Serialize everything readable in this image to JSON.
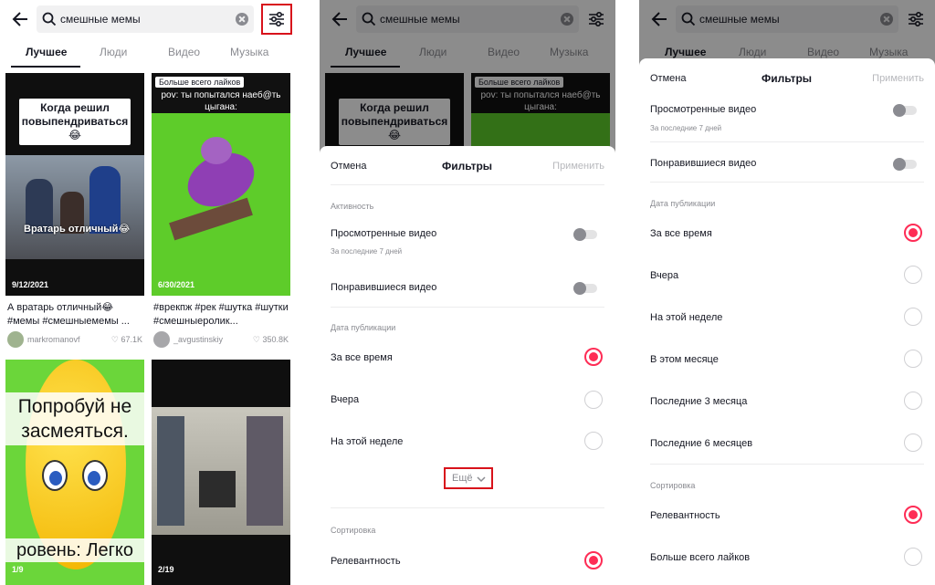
{
  "search": {
    "query": "смешные мемы"
  },
  "tabs": [
    "Лучшее",
    "Люди",
    "Видео",
    "Музыка"
  ],
  "videos": [
    {
      "caption_overlay": "Когда решил повыпендриваться😂",
      "scene_text": "Вратарь отличный😂",
      "date": "9/12/2021",
      "caption": "А вратарь отличный😂 #мемы #смешныемемы ...",
      "author": "markromanovf",
      "likes": "67.1K"
    },
    {
      "badge": "Больше всего лайков",
      "caption_overlay": "pov: ты попытался наеб@ть цыгана:",
      "date": "6/30/2021",
      "caption": "#врекпж #рек #шутка #шутки #смешныеролик...",
      "author": "_avgustinskiy",
      "likes": "350.8K"
    },
    {
      "overlay_top": "Попробуй не засмеяться.",
      "overlay_bottom": "ровень: Легко",
      "date": "1/9"
    },
    {
      "date": "2/19"
    }
  ],
  "filters": {
    "cancel": "Отмена",
    "title": "Фильтры",
    "apply": "Применить",
    "activity_header": "Активность",
    "watched": "Просмотренные видео",
    "watched_sub": "За последние 7 дней",
    "liked": "Понравившиеся видео",
    "date_header": "Дата публикации",
    "date_options": [
      "За все время",
      "Вчера",
      "На этой неделе",
      "В этом месяце",
      "Последние 3 месяца",
      "Последние 6 месяцев"
    ],
    "more": "Ещё",
    "sort_header": "Сортировка",
    "sort_options": [
      "Релевантность",
      "Больше всего лайков"
    ]
  },
  "colors": {
    "accent": "#fe2c55",
    "highlight": "#d8121b"
  }
}
